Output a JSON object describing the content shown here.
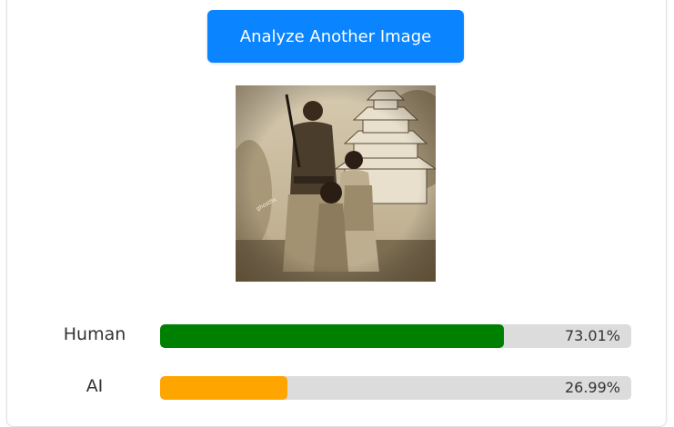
{
  "action": {
    "label": "Analyze Another Image"
  },
  "image": {
    "description_icon": "photo-thumbnail",
    "overlay_text": "ghostfix"
  },
  "results": [
    {
      "label": "Human",
      "percent_text": "73.01%",
      "fraction": 0.7301,
      "color": "#008000"
    },
    {
      "label": "AI",
      "percent_text": "26.99%",
      "fraction": 0.2699,
      "color": "#ffa500"
    }
  ],
  "colors": {
    "button": "#0a84ff",
    "track": "#dcdcdc"
  }
}
